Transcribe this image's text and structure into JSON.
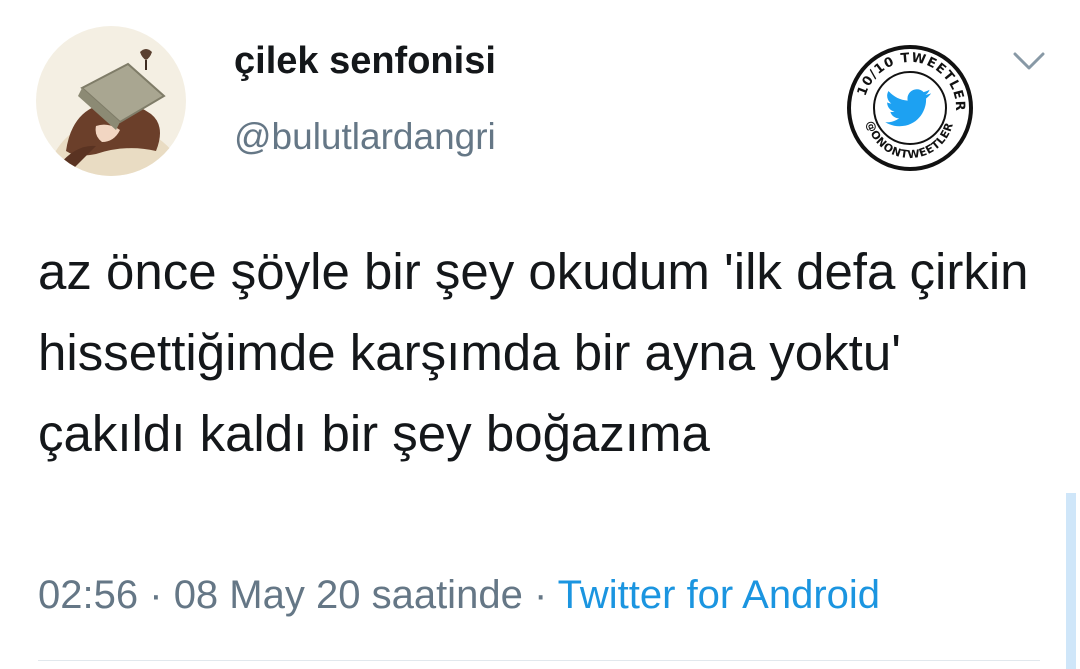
{
  "author": {
    "display_name": "çilek senfonisi",
    "handle": "@bulutlardangri"
  },
  "tweet": {
    "text": "az önce şöyle bir şey okudum 'ilk defa çirkin hissettiğimde karşımda bir ayna yoktu' çakıldı kaldı bir şey boğazıma",
    "time": "02:56",
    "separator": "·",
    "date_phrase": "08 May 20 saatinde",
    "separator2": "·",
    "source": "Twitter for Android"
  },
  "stamp": {
    "text": "10/10 TWEETLER @ONONTWEETLER"
  },
  "colors": {
    "text": "#14171a",
    "muted": "#657786",
    "link": "#1b95e0",
    "twitter_blue": "#1da1f2"
  },
  "icons": {
    "menu": "chevron-down-icon",
    "stamp_bird": "twitter-bird-icon"
  }
}
